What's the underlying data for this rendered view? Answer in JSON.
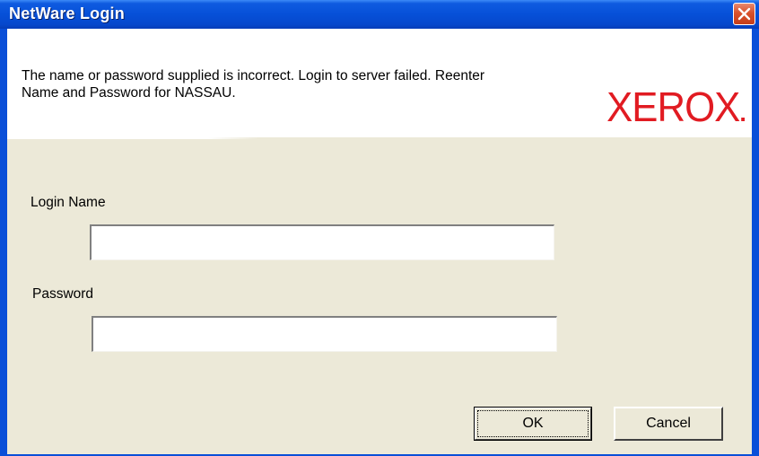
{
  "window": {
    "title": "NetWare Login"
  },
  "header": {
    "message_line1": "The name or password supplied is incorrect. Login to server failed. Reenter",
    "message_line2": "Name and Password for NASSAU.",
    "logo_text": "XEROX",
    "logo_color": "#e11b22"
  },
  "form": {
    "login_name_label": "Login Name",
    "login_name_value": "",
    "password_label": "Password",
    "password_value": ""
  },
  "buttons": {
    "ok_label": "OK",
    "cancel_label": "Cancel"
  },
  "icons": {
    "close": "close-icon"
  },
  "colors": {
    "titlebar": "#0650d8",
    "client_background": "#ece9d8",
    "close_button": "#d9512b"
  }
}
